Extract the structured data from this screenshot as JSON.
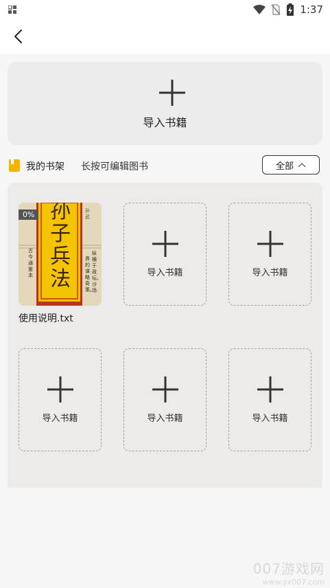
{
  "status_bar": {
    "time": "1:37",
    "icons": [
      "grid-icon",
      "wifi-icon",
      "no-sim-icon",
      "battery-charging-icon"
    ]
  },
  "toolbar": {
    "back_icon": "chevron-left-icon"
  },
  "import_card": {
    "label": "导入书籍",
    "icon": "plus-icon"
  },
  "shelf": {
    "title": "我的书架",
    "hint": "长按可编辑图书",
    "filter_label": "全部",
    "filter_icon": "chevron-up-icon",
    "books": [
      {
        "name": "使用说明.txt",
        "progress": "0%",
        "cover": {
          "title_chars": [
            "孙",
            "子",
            "兵",
            "法"
          ],
          "author": "孙武",
          "side_text_1": "古今通鉴本",
          "side_text_2": "纵横于政坛、沙场",
          "side_text_3": "界的谋略奇策。"
        }
      }
    ],
    "slot_label": "导入书籍",
    "slots": [
      {
        "label": "导入书籍"
      },
      {
        "label": "导入书籍"
      },
      {
        "label": "导入书籍"
      },
      {
        "label": "导入书籍"
      },
      {
        "label": "导入书籍"
      }
    ]
  },
  "watermark": {
    "main": "007游戏网",
    "url": "www.yx007.com"
  },
  "colors": {
    "cover_yellow": "#f5c400",
    "cover_red": "#b8341f",
    "panel_bg": "#ecebea"
  }
}
